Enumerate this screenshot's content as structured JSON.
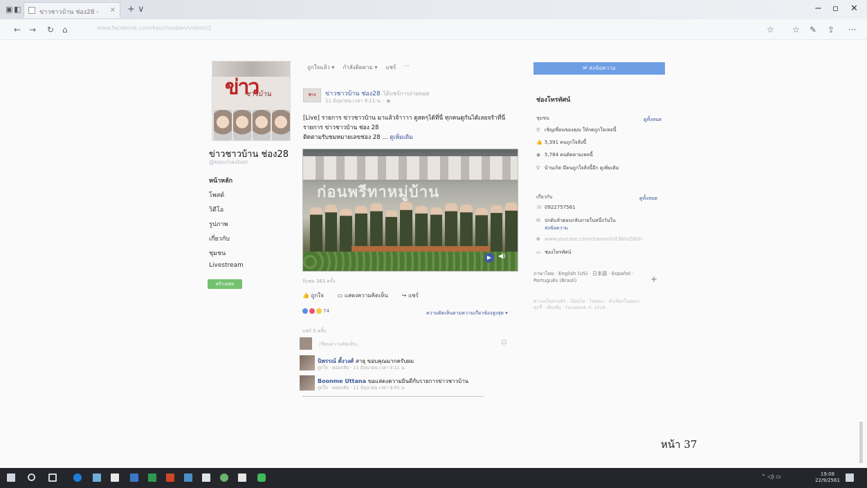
{
  "browser": {
    "tab_title": "ข่าวชาวบ้าน ช่อง28 -",
    "tab_close": "×",
    "new_tab": "+ ∨",
    "address": "www.facebook.com/kaochaoban/videos/1",
    "window_controls": {
      "minimize": "−",
      "restore": "▫",
      "close": "✕"
    }
  },
  "page": {
    "name": "ข่าวชาวบ้าน ช่อง28",
    "username": "@kaochaoban",
    "cover_logo": "ข่าว",
    "cover_logo_sub": "ชาวบ้าน",
    "nav": [
      "หน้าหลัก",
      "โพสต์",
      "วิดีโอ",
      "รูปภาพ",
      "เกี่ยวกับ",
      "ชุมชน",
      "Livestream"
    ],
    "create_page_label": "สร้างเพจ"
  },
  "post": {
    "action_bar": [
      "ถูกใจแล้ว ▾",
      "กำลังติดตาม ▾",
      "แชร์",
      "···"
    ],
    "author": "ข่าวชาวบ้าน ช่อง28",
    "author_sub": "ได้แชร์การถ่ายทอด",
    "avatar_text": "ข่าว",
    "time": "11 มิถุนายน เวลา 9:11 น. · ◉",
    "text_line1": "[Live] รายการ ข่าวชาวบ้าน มาแล้วจ้าาาา ดูสดๆได้ที่นี่ ทุกคนดูกันได้เลยจร้าที่นี่",
    "text_line2": "รายการ ข่าวชาวบ้าน ช่อง 28",
    "text_line3": "ติดตามรับชมหมายเลขช่อง 28 ...",
    "see_more": "ดูเพิ่มเติม",
    "photo_banner": "ก่อนพรีทาหมู่บ้าน",
    "photo_play": "▶",
    "photo_volume": "◀)",
    "views": "รับชม 363 ครั้ง",
    "like": "ถูกใจ",
    "comment": "แสดงความคิดเห็น",
    "share": "แชร์",
    "reaction_count": "74",
    "reaction_more": "ความคิดเห็นตามความเกี่ยวข้องสูงสุด ▾",
    "shares_count": "แชร์ 5 ครั้ง",
    "comment_placeholder": "เขียนความคิดเห็น...",
    "comment_icon": "☺",
    "comments": [
      {
        "name": "นิพรรณ์ ตั้งวงศ์",
        "text": "สาธุ ขอบคุณมากครับผม",
        "meta": "ถูกใจ · ตอบกลับ · 11 มิถุนายน เวลา 9:11 น."
      },
      {
        "name": "Boonme Uttana",
        "text": "ขอแสดงความยินดีกับรายการข่าวชาวบ้าน",
        "meta": "ถูกใจ · ตอบกลับ · 11 มิถุนายน เวลา 9:05 น."
      }
    ]
  },
  "sidebar": {
    "message_button": "✉ ส่งข้อความ",
    "heading": "ช่องโทรทัศน์",
    "community": "ชุมชน",
    "see_all_1": "ดูทั้งหมด",
    "community_rows": [
      {
        "icon": "⚲",
        "text": "เชิญเพื่อนของคุณ ให้กดถูกใจเพจนี้"
      },
      {
        "icon": "👍",
        "text": "5,391 คนถูกใจสิ่งนี้"
      },
      {
        "icon": "◉",
        "text": "5,784 คนติดตามเพจนี้"
      },
      {
        "icon": "⚲",
        "text": "บ้านเกิด มีคนถูกใจสิ่งนี้อีก ดูเพิ่มเติม"
      }
    ],
    "about": "เกี่ยวกับ",
    "see_all_2": "ดูทั้งหมด",
    "about_rows": [
      {
        "icon": "☏",
        "text": "0922757561"
      },
      {
        "icon": "✉",
        "text": "ปกติแล้วตอบกลับภายในหนึ่งวันใน"
      },
      {
        "icon": "",
        "text": "ส่งข้อความ"
      },
      {
        "icon": "⊕",
        "text": "www.youtube.com/channel/UC6kinZ6Gh"
      },
      {
        "icon": "▭",
        "text": "ช่องโทรทัศน์"
      }
    ],
    "languages": "ภาษาไทย · English (US) · 日本語 · Español · Português (Brasil)",
    "lang_plus": "+",
    "footer": "ความเป็นส่วนตัว · เงื่อนไข · โฆษณา · ตัวเลือกโฆษณา · คุกกี้ · เพิ่มเติม · Facebook © 2018"
  },
  "document": {
    "page_number": "หน้า 37"
  },
  "taskbar": {
    "time": "19:08",
    "date": "22/9/2561",
    "tray": "⌃ ◁) ▭"
  },
  "colors": {
    "fb_blue": "#3b5998",
    "message_blue": "#6e9ee3",
    "green": "#74c26f",
    "taskbar": "#24262b"
  }
}
